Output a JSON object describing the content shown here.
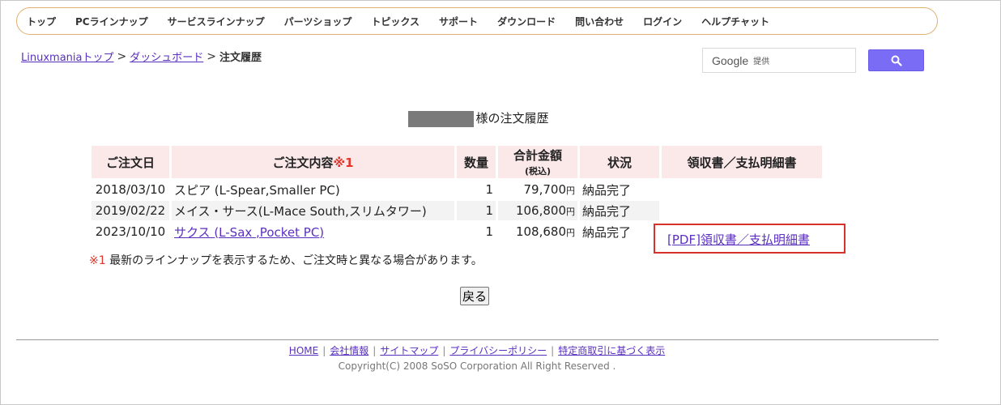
{
  "nav": {
    "items": [
      "トップ",
      "PCラインナップ",
      "サービスラインナップ",
      "パーツショップ",
      "トピックス",
      "サポート",
      "ダウンロード",
      "問い合わせ",
      "ログイン",
      "ヘルプチャット"
    ]
  },
  "breadcrumb": {
    "items": [
      "Linuxmaniaトップ",
      "ダッシュボード"
    ],
    "separator": ">",
    "current": "注文履歴"
  },
  "search": {
    "brand": "Google",
    "provided": "提供",
    "button_icon": "search-icon"
  },
  "heading": {
    "suffix": "様の注文履歴"
  },
  "table": {
    "headers": {
      "date": "ご注文日",
      "content": "ご注文内容",
      "content_mark": "※1",
      "qty": "数量",
      "total": "合計金額",
      "total_sub": "(税込)",
      "status": "状況",
      "receipt": "領収書／支払明細書"
    },
    "yen": "円",
    "rows": [
      {
        "date": "2018/03/10",
        "content": "スピア (L-Spear,Smaller PC)",
        "qty": "1",
        "total": "79,700",
        "status": "納品完了"
      },
      {
        "date": "2019/02/22",
        "content": "メイス・サース(L-Mace South,スリムタワー)",
        "qty": "1",
        "total": "106,800",
        "status": "納品完了"
      },
      {
        "date": "2023/10/10",
        "content": "サクス (L-Sax ,Pocket PC)",
        "qty": "1",
        "total": "108,680",
        "status": "納品完了",
        "receipt": "[PDF]領収書／支払明細書"
      }
    ]
  },
  "note": {
    "mark": "※1",
    "text": " 最新のラインナップを表示するため、ご注文時と異なる場合があります。"
  },
  "back_button": "戻る",
  "footer": {
    "links": [
      "HOME",
      "会社情報",
      "サイトマップ",
      "プライバシーポリシー",
      "特定商取引に基づく表示"
    ],
    "copyright": "Copyright(C) 2008 SoSO Corporation All Right Reserved ."
  },
  "colors": {
    "nav_border": "#e0b070",
    "link": "#5a2fbf",
    "header_bg": "#fbe9ea",
    "search_button": "#7b6cf6",
    "highlight_border": "#d9322b",
    "asterisk": "#e2362c"
  }
}
